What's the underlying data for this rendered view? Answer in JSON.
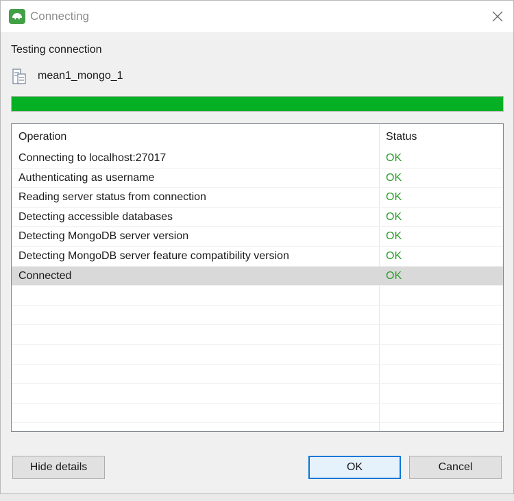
{
  "window": {
    "title": "Connecting",
    "accent": "#43a047"
  },
  "dialog": {
    "subtitle": "Testing connection",
    "connection_name": "mean1_mongo_1",
    "progress_fraction": 1.0,
    "progress_color": "#06b025"
  },
  "table": {
    "headers": {
      "operation": "Operation",
      "status": "Status"
    },
    "rows": [
      {
        "operation": "Connecting to localhost:27017",
        "status": "OK"
      },
      {
        "operation": "Authenticating as username",
        "status": "OK"
      },
      {
        "operation": "Reading server status from connection",
        "status": "OK"
      },
      {
        "operation": "Detecting accessible databases",
        "status": "OK"
      },
      {
        "operation": "Detecting MongoDB server version",
        "status": "OK"
      },
      {
        "operation": "Detecting MongoDB server feature compatibility version",
        "status": "OK"
      },
      {
        "operation": "Connected",
        "status": "OK"
      }
    ],
    "selected_index": 6,
    "status_color": "#2a9d2a"
  },
  "buttons": {
    "hide_details": "Hide details",
    "ok": "OK",
    "cancel": "Cancel"
  },
  "icons": {
    "app": "mongo-leaf-icon",
    "close": "close-icon",
    "database": "database-icon"
  }
}
